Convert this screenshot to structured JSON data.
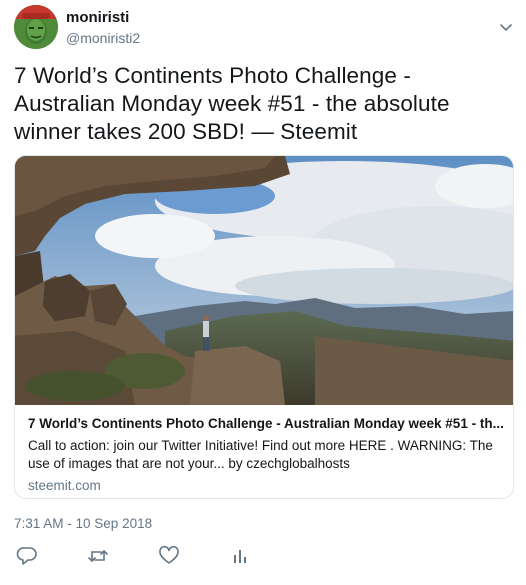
{
  "author": {
    "display_name": "moniristi",
    "handle": "@moniristi2"
  },
  "tweet": {
    "text": "7 World’s Continents Photo Challenge - Australian Monday week #51 - the absolute winner takes 200 SBD! — Steemit",
    "timestamp": "7:31 AM - 10 Sep 2018"
  },
  "card": {
    "title": "7 World’s Continents Photo Challenge - Australian Monday week #51 - th...",
    "description": "Call to action: join our Twitter Initiative! Find out more HERE . WARNING: The use of images that are not your... by czechglobalhosts",
    "domain": "steemit.com"
  },
  "icons": {
    "menu": "chevron-down-icon",
    "reply": "reply-icon",
    "retweet": "retweet-icon",
    "like": "heart-icon",
    "analytics": "analytics-icon"
  },
  "colors": {
    "text": "#14171a",
    "muted": "#657786",
    "border": "#e1e8ed"
  }
}
